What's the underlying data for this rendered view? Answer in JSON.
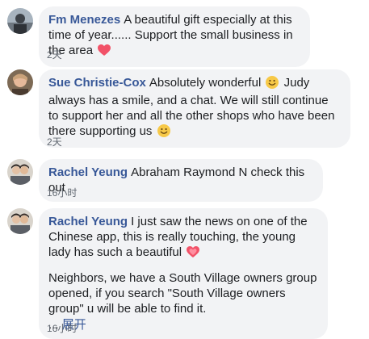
{
  "comments": [
    {
      "author": "Fm Menezes",
      "text": "A beautiful gift especially at this time of year...... Support the small business in the area",
      "emoji": "heart-emoji",
      "time": "2天"
    },
    {
      "author": "Sue Christie-Cox",
      "text_a": "Absolutely wonderful",
      "text_b": "Judy always has a smile, and a chat. We will still continue to support her and all the other shops who have been there supporting us",
      "emoji": "smiley-emoji",
      "time": "2天"
    },
    {
      "author": "Rachel Yeung",
      "text": "Abraham Raymond N check this out",
      "time": "16小时"
    },
    {
      "author": "Rachel Yeung",
      "text": "I just saw the news on one of the Chinese app, this is really touching, the young lady has such a beautiful",
      "emoji": "growing-heart-emoji",
      "text2": "Neighbors, we have a South Village owners group opened, if you search \"South Village owners group\" u will be able to find it.",
      "ellipsis": "...",
      "see_more": "展开",
      "time": "16小时"
    }
  ],
  "colors": {
    "bubble": "#f2f3f5",
    "author": "#385898",
    "text": "#1c1e21",
    "timestamp": "#606770",
    "heart": "#f25268",
    "smiley": "#f7c948"
  }
}
